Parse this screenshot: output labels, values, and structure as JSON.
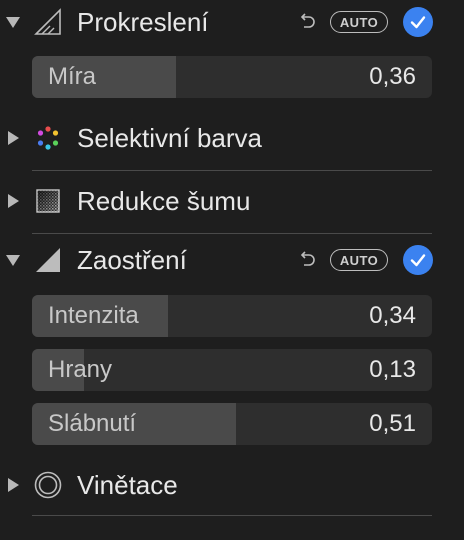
{
  "colors": {
    "background": "#1e1e1e",
    "slider_track": "#2e2e2e",
    "slider_fill": "#4a4a4a",
    "check_blue": "#3b82f0"
  },
  "sections": {
    "sharpening_de": {
      "title": "Prokreslení",
      "expanded": true,
      "icon": "triangle-outline-icon",
      "auto_label": "AUTO",
      "enabled": true,
      "sliders": [
        {
          "label": "Míra",
          "value": "0,36",
          "fraction": 0.36
        }
      ]
    },
    "selective_color": {
      "title": "Selektivní barva",
      "expanded": false,
      "icon": "color-dots-icon"
    },
    "noise_reduction": {
      "title": "Redukce šumu",
      "expanded": false,
      "icon": "noise-square-icon"
    },
    "sharpen": {
      "title": "Zaostření",
      "expanded": true,
      "icon": "triangle-filled-icon",
      "auto_label": "AUTO",
      "enabled": true,
      "sliders": [
        {
          "label": "Intenzita",
          "value": "0,34",
          "fraction": 0.34
        },
        {
          "label": "Hrany",
          "value": "0,13",
          "fraction": 0.13
        },
        {
          "label": "Slábnutí",
          "value": "0,51",
          "fraction": 0.51
        }
      ]
    },
    "vignette": {
      "title": "Vinětace",
      "expanded": false,
      "icon": "vignette-circle-icon"
    }
  }
}
